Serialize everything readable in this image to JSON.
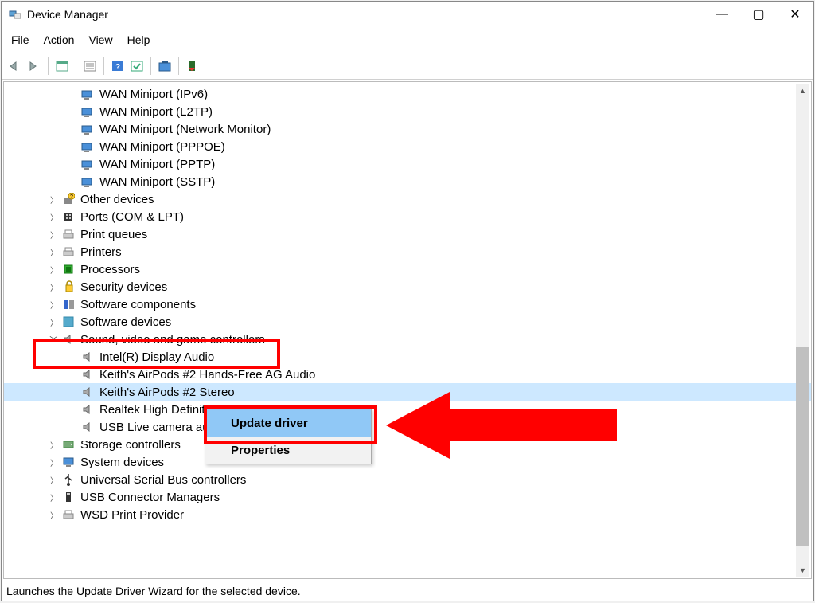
{
  "window": {
    "title": "Device Manager",
    "controls": {
      "min": "—",
      "max": "▢",
      "close": "✕"
    }
  },
  "menu": {
    "file": "File",
    "action": "Action",
    "view": "View",
    "help": "Help"
  },
  "tree": {
    "net": {
      "wan_ipv6": "WAN Miniport (IPv6)",
      "wan_l2tp": "WAN Miniport (L2TP)",
      "wan_nm": "WAN Miniport (Network Monitor)",
      "wan_pppoe": "WAN Miniport (PPPOE)",
      "wan_pptp": "WAN Miniport (PPTP)",
      "wan_sstp": "WAN Miniport (SSTP)"
    },
    "categories": {
      "other": "Other devices",
      "ports": "Ports (COM & LPT)",
      "printqueues": "Print queues",
      "printers": "Printers",
      "processors": "Processors",
      "security": "Security devices",
      "softcomp": "Software components",
      "softdev": "Software devices",
      "sound": "Sound, video and game controllers",
      "storage": "Storage controllers",
      "system": "System devices",
      "usbctrl": "Universal Serial Bus controllers",
      "usbconn": "USB Connector Managers",
      "wsd": "WSD Print Provider"
    },
    "sound_children": {
      "intel": "Intel(R) Display Audio",
      "ap_handsfree": "Keith's AirPods #2 Hands-Free AG Audio",
      "ap_stereo": "Keith's AirPods #2 Stereo",
      "realtek": "Realtek High Definition Audio",
      "usblive": "USB Live camera audio"
    }
  },
  "context": {
    "update": "Update driver",
    "properties": "Properties"
  },
  "status": "Launches the Update Driver Wizard for the selected device."
}
